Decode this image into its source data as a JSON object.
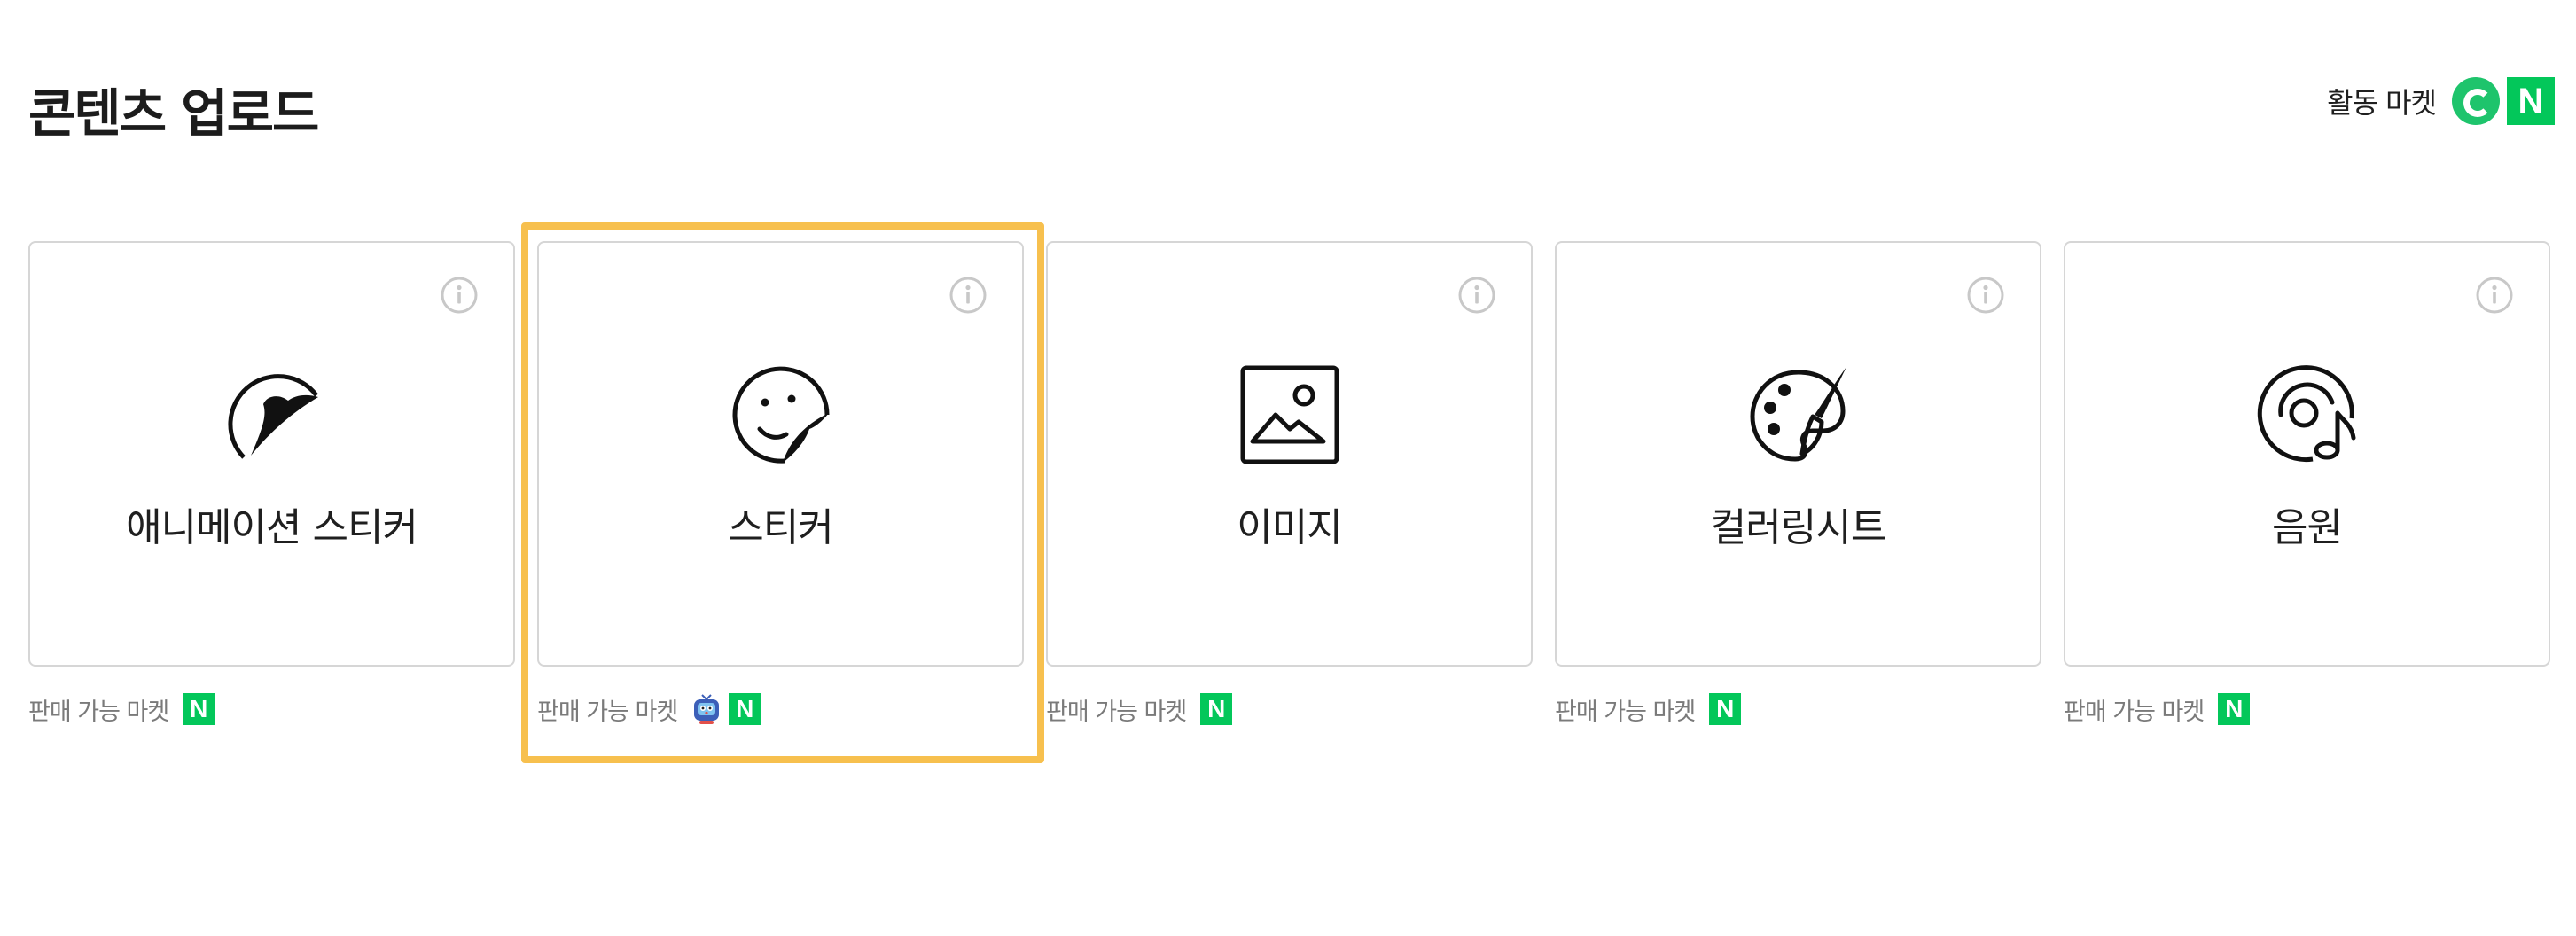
{
  "page": {
    "title": "콘텐츠 업로드"
  },
  "active_markets": {
    "label": "활동 마켓",
    "icons": [
      "green-store-icon",
      "naver-n-icon"
    ]
  },
  "market_label": "판매 가능 마켓",
  "market_n_glyph": "N",
  "cards": [
    {
      "label": "애니메이션 스티커",
      "icon": "animated-sticker-icon",
      "markets": [
        "naver-n-icon"
      ],
      "selected": false
    },
    {
      "label": "스티커",
      "icon": "sticker-face-icon",
      "markets": [
        "tv-character-icon",
        "naver-n-icon"
      ],
      "selected": true
    },
    {
      "label": "이미지",
      "icon": "image-icon",
      "markets": [
        "naver-n-icon"
      ],
      "selected": false
    },
    {
      "label": "컬러링시트",
      "icon": "palette-icon",
      "markets": [
        "naver-n-icon"
      ],
      "selected": false
    },
    {
      "label": "음원",
      "icon": "music-disc-icon",
      "markets": [
        "naver-n-icon"
      ],
      "selected": false
    }
  ],
  "colors": {
    "selected_frame": "#f7c04e",
    "naver_green": "#03c75a",
    "store_green": "#1ec46c",
    "card_border": "#d6d6d6"
  }
}
